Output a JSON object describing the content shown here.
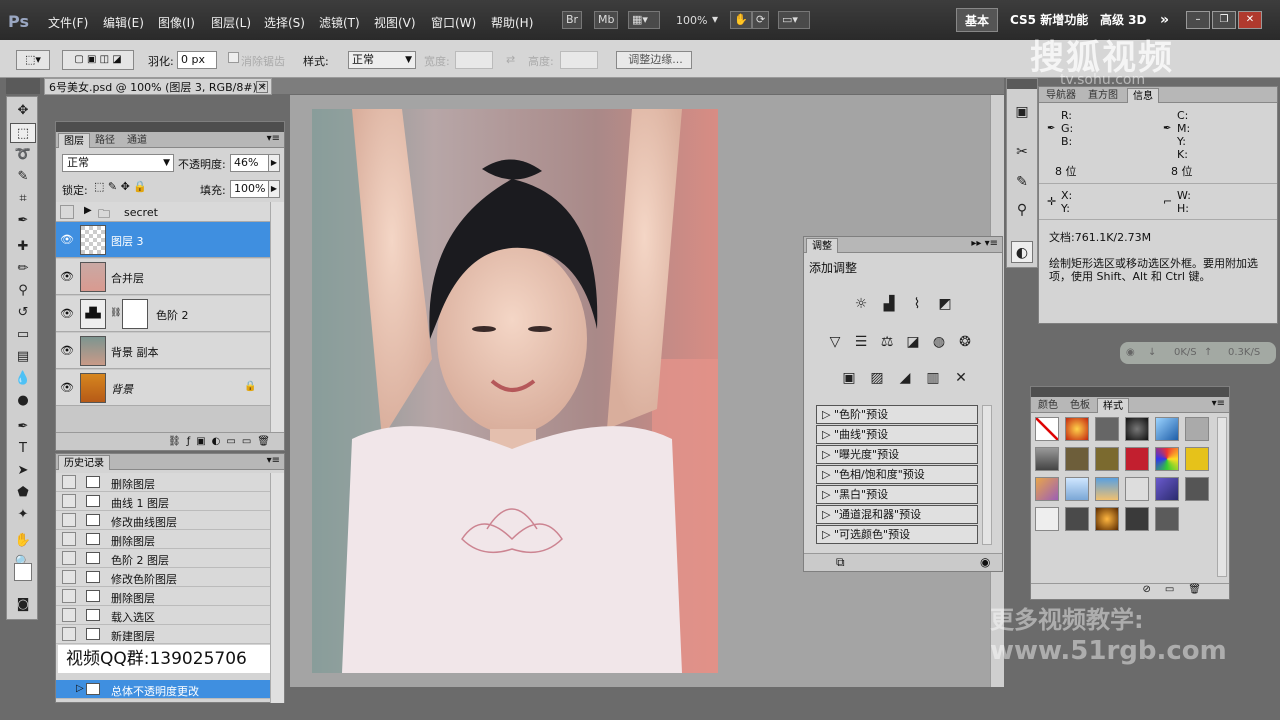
{
  "menubar": {
    "logo": "Ps",
    "items": [
      "文件(F)",
      "编辑(E)",
      "图像(I)",
      "图层(L)",
      "选择(S)",
      "滤镜(T)",
      "视图(V)",
      "窗口(W)",
      "帮助(H)"
    ],
    "br": "Br",
    "mb": "Mb",
    "zoom": "100%",
    "workspaces": [
      "基本",
      "CS5 新增功能",
      "高级 3D"
    ],
    "more": "»"
  },
  "options": {
    "feather_label": "羽化:",
    "feather_value": "0 px",
    "antialias_label": "消除锯齿",
    "style_label": "样式:",
    "style_value": "正常",
    "width_label": "宽度:",
    "height_label": "高度:",
    "refine_edge": "调整边缘..."
  },
  "watermark": {
    "main": "搜狐视频",
    "sub": "tv.sohu.com"
  },
  "document": {
    "tab_title": "6号美女.psd @ 100% (图层 3, RGB/8#) *",
    "close": "×"
  },
  "layers_panel": {
    "tabs": [
      "图层",
      "路径",
      "通道"
    ],
    "blend_mode": "正常",
    "opacity_label": "不透明度:",
    "opacity_value": "46%",
    "lock_label": "锁定:",
    "fill_label": "填充:",
    "fill_value": "100%",
    "group_name": "secret",
    "layers": [
      "图层 3",
      "合并层",
      "色阶 2",
      "背景 副本",
      "背景"
    ]
  },
  "history_panel": {
    "title": "历史记录",
    "items": [
      "删除图层",
      "曲线 1 图层",
      "修改曲线图层",
      "删除图层",
      "色阶 2 图层",
      "修改色阶图层",
      "删除图层",
      "载入选区",
      "新建图层"
    ],
    "selected": "总体不透明度更改",
    "qq_banner": "视频QQ群:139025706"
  },
  "adjust_panel": {
    "tab": "调整",
    "title": "添加调整",
    "presets": [
      "\"色阶\"预设",
      "\"曲线\"预设",
      "\"曝光度\"预设",
      "\"色相/饱和度\"预设",
      "\"黑白\"预设",
      "\"通道混和器\"预设",
      "\"可选颜色\"预设"
    ]
  },
  "info_panel": {
    "tabs": [
      "导航器",
      "直方图",
      "信息"
    ],
    "r": "R:",
    "g": "G:",
    "b": "B:",
    "c": "C:",
    "m": "M:",
    "y": "Y:",
    "k": "K:",
    "bits_left": "8 位",
    "bits_right": "8 位",
    "x": "X:",
    "yy": "Y:",
    "w": "W:",
    "h": "H:",
    "doc": "文档:761.1K/2.73M",
    "hint": "绘制矩形选区或移动选区外框。要用附加选项，使用 Shift、Alt 和 Ctrl 键。"
  },
  "net_widget": {
    "down": "0K/S",
    "up": "0.3K/S"
  },
  "styles_panel": {
    "tabs": [
      "颜色",
      "色板",
      "样式"
    ]
  },
  "bottom_watermark": {
    "line1": "更多视频教学:",
    "line2": "www.51rgb.com"
  },
  "colors": {
    "selection": "#3f8fe0",
    "panel": "#d4d4d4"
  }
}
